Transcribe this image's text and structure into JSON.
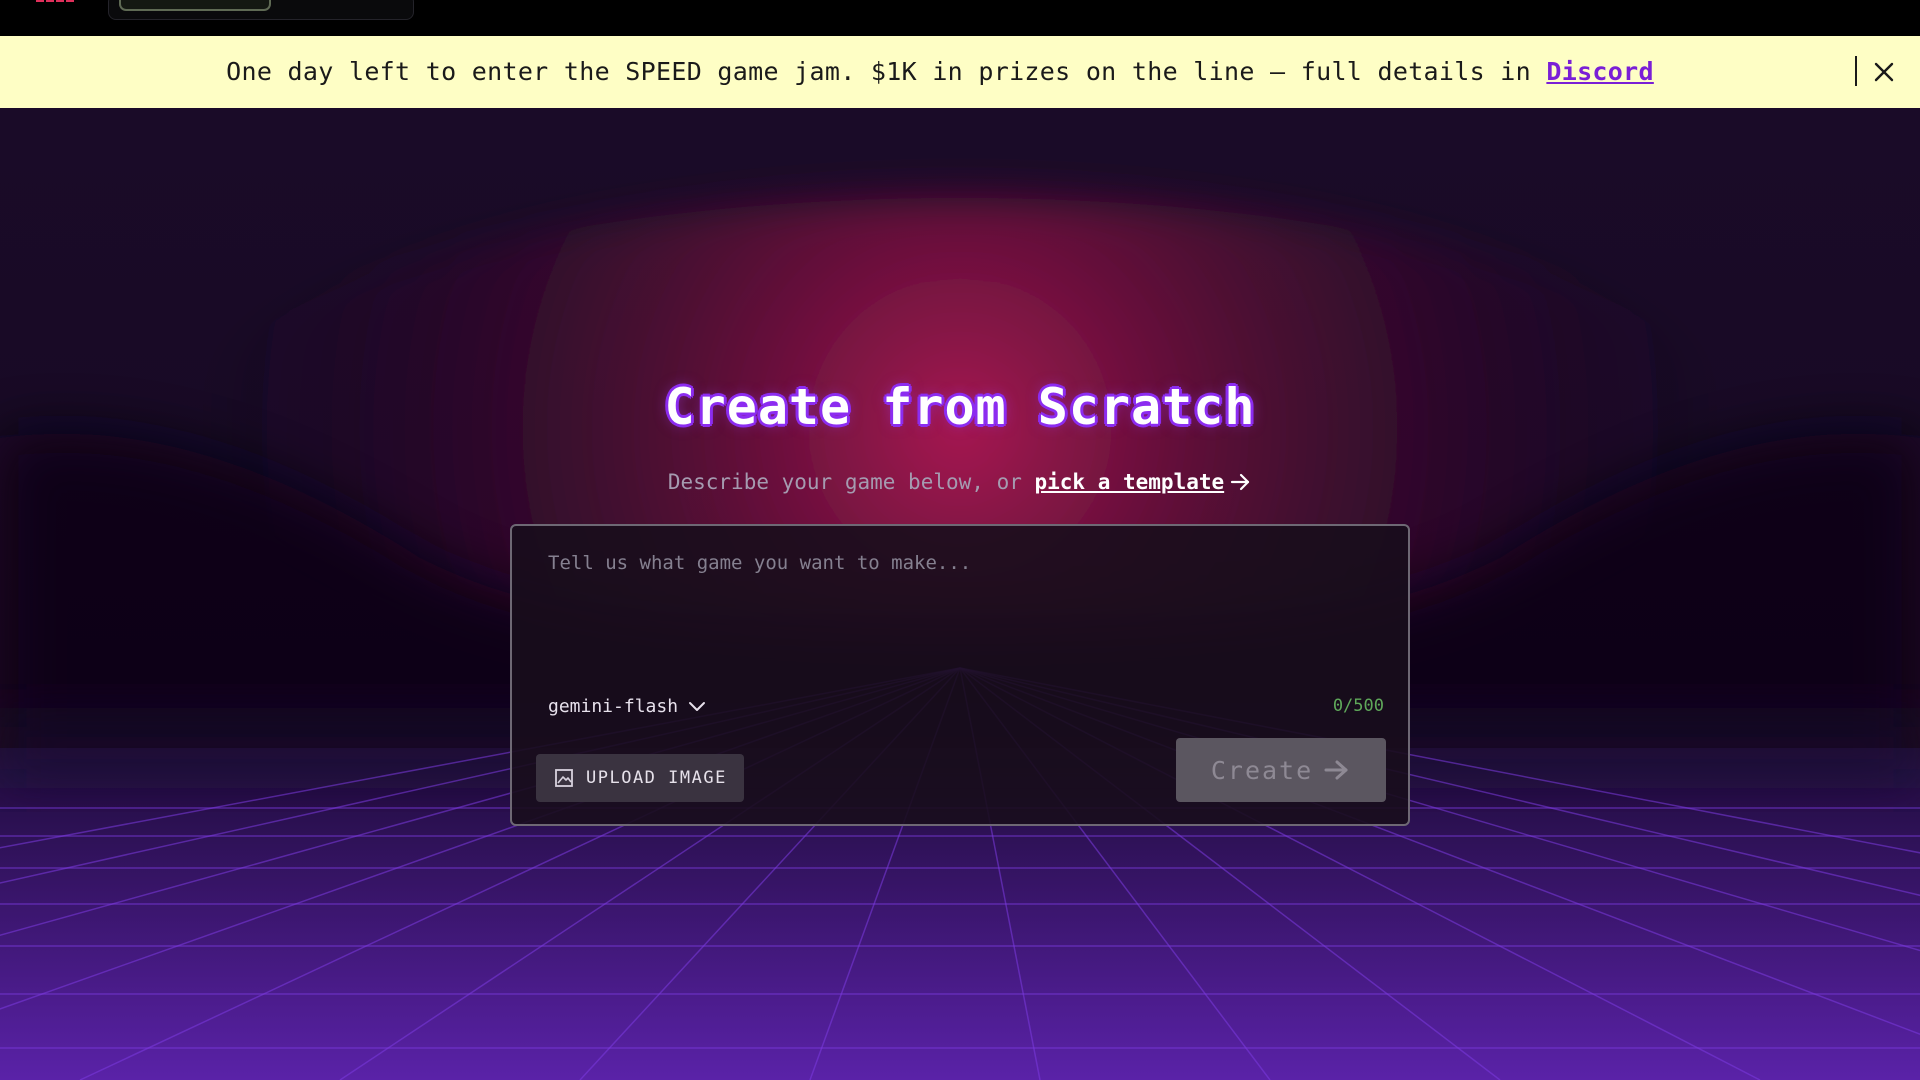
{
  "banner": {
    "message": "One day left to enter the SPEED game jam. $1K in prizes on the line — full details in ",
    "link_label": "Discord"
  },
  "main": {
    "title": "Create from Scratch",
    "subtitle_prefix": "Describe your game below, or ",
    "subtitle_link": "pick a template"
  },
  "prompt": {
    "placeholder": "Tell us what game you want to make...",
    "value": "",
    "model": "gemini-flash",
    "char_count": "0/500",
    "upload_label": "UPLOAD IMAGE",
    "create_label": "Create"
  },
  "icons": {
    "logo": "pixel-logo-icon",
    "close": "close-icon",
    "arrow": "arrow-right-icon",
    "chevron": "chevron-down-icon",
    "image": "image-icon"
  },
  "colors": {
    "banner_bg": "#fefec5",
    "accent_purple": "#8c2cf0",
    "grid_purple": "#6a27c8",
    "count_green": "#5fa85a",
    "create_disabled_bg": "#5b5660"
  }
}
